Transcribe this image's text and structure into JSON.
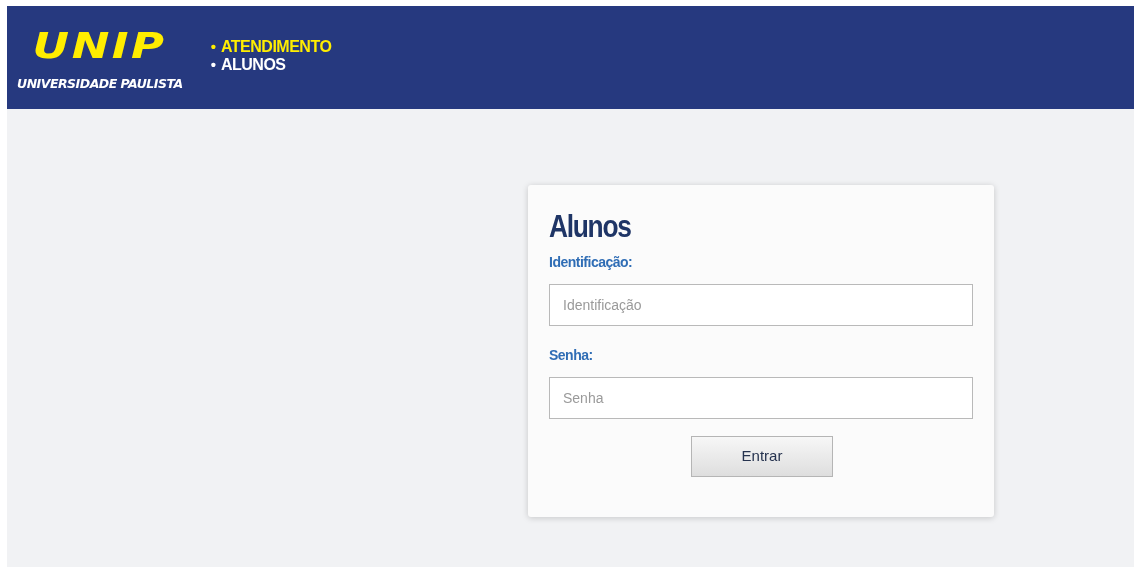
{
  "header": {
    "logo": {
      "wordmark": "UNIP",
      "subtitle": "UNIVERSIDADE PAULISTA"
    },
    "nav": [
      {
        "bullet": "•",
        "label": "ATENDIMENTO",
        "color": "#ffed00"
      },
      {
        "bullet": "•",
        "label": "ALUNOS",
        "color": "#ffffff"
      }
    ]
  },
  "login": {
    "title": "Alunos",
    "fields": [
      {
        "label": "Identificação:",
        "placeholder": "Identificação"
      },
      {
        "label": "Senha:",
        "placeholder": "Senha"
      }
    ],
    "button": "Entrar"
  }
}
